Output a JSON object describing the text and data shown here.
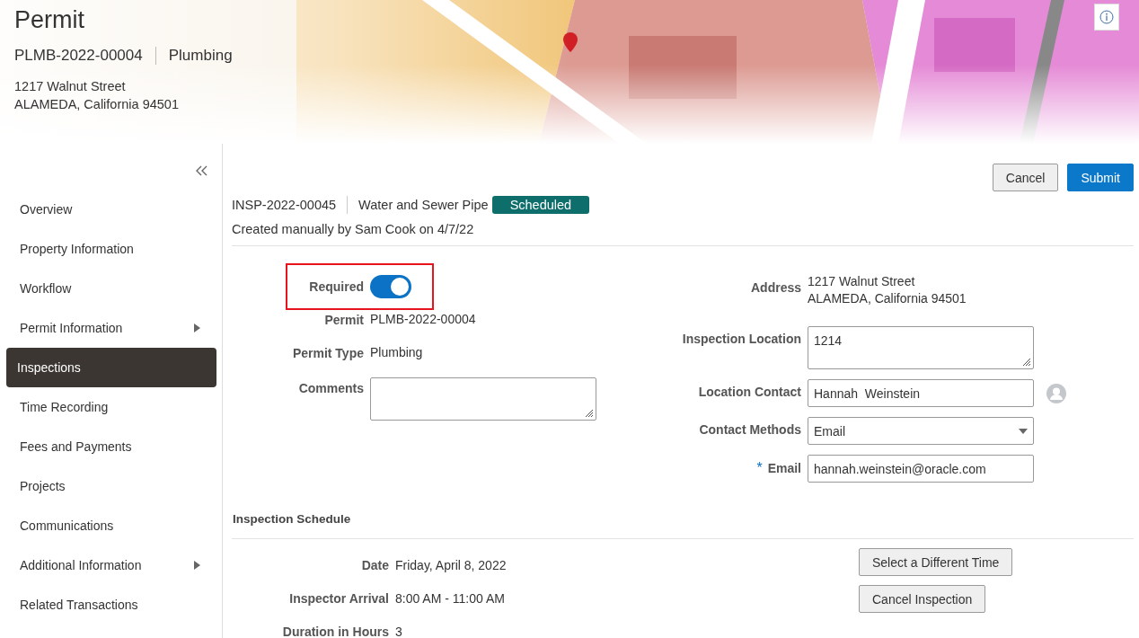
{
  "header": {
    "title": "Permit",
    "permit_number": "PLMB-2022-00004",
    "permit_type": "Plumbing",
    "address_lines": [
      "1217 Walnut Street",
      "ALAMEDA, California 94501"
    ]
  },
  "sidebar": {
    "items": [
      {
        "label": "Overview",
        "selected": false,
        "has_submenu": false
      },
      {
        "label": "Property Information",
        "selected": false,
        "has_submenu": false
      },
      {
        "label": "Workflow",
        "selected": false,
        "has_submenu": false
      },
      {
        "label": "Permit Information",
        "selected": false,
        "has_submenu": true
      },
      {
        "label": "Inspections",
        "selected": true,
        "has_submenu": false
      },
      {
        "label": "Time Recording",
        "selected": false,
        "has_submenu": false
      },
      {
        "label": "Fees and Payments",
        "selected": false,
        "has_submenu": false
      },
      {
        "label": "Projects",
        "selected": false,
        "has_submenu": false
      },
      {
        "label": "Communications",
        "selected": false,
        "has_submenu": false
      },
      {
        "label": "Additional Information",
        "selected": false,
        "has_submenu": true
      },
      {
        "label": "Related Transactions",
        "selected": false,
        "has_submenu": false
      }
    ]
  },
  "actions": [
    {
      "label": "Cancel",
      "kind": "secondary"
    },
    {
      "label": "Submit",
      "kind": "primary"
    }
  ],
  "inspection": {
    "id": "INSP-2022-00045",
    "type": "Water and Sewer Pipe",
    "status": "Scheduled",
    "created": "Created manually by Sam Cook on 4/7/22"
  },
  "form_left": [
    {
      "label": "Required",
      "kind": "toggle",
      "on": true,
      "highlighted": true
    },
    {
      "label": "Permit",
      "kind": "text",
      "lines": [
        "PLMB-2022-00004"
      ]
    },
    {
      "label": "Permit Type",
      "kind": "text",
      "lines": [
        "Plumbing"
      ]
    },
    {
      "label": "Comments",
      "kind": "textarea"
    }
  ],
  "form_right": [
    {
      "label": "Address",
      "kind": "text",
      "lines": [
        "1217 Walnut Street",
        "ALAMEDA, California 94501"
      ]
    },
    {
      "label": "Inspection Location",
      "kind": "textarea",
      "value": "1214"
    },
    {
      "label": "Location Contact",
      "kind": "input",
      "value": "Hannah  Weinstein",
      "contact_icon": true
    },
    {
      "label": "Contact Methods",
      "kind": "select",
      "value": "Email"
    },
    {
      "label": "Email",
      "kind": "input",
      "value": "hannah.weinstein@oracle.com",
      "required_mark": "*"
    }
  ],
  "schedule": {
    "title": "Inspection Schedule",
    "rows": [
      {
        "label": "Date",
        "value": "Friday, April 8, 2022"
      },
      {
        "label": "Inspector Arrival",
        "value": "8:00 AM - 11:00 AM"
      },
      {
        "label": "Duration in Hours",
        "value": "3"
      }
    ],
    "buttons": [
      "Select a Different Time",
      "Cancel Inspection"
    ]
  }
}
